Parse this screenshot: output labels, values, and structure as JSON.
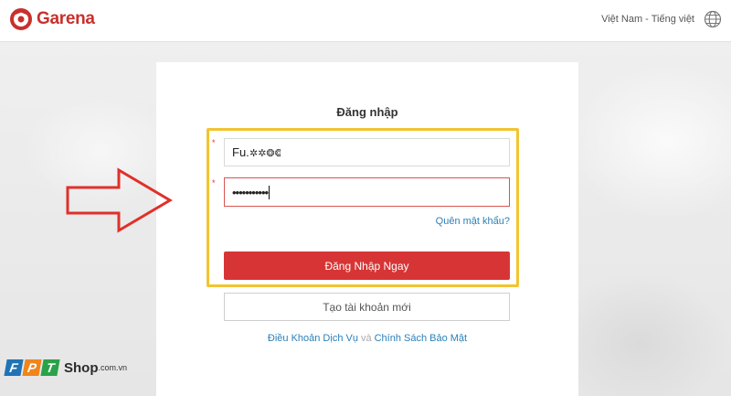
{
  "header": {
    "brand": "Garena",
    "language": "Việt Nam - Tiếng việt"
  },
  "login": {
    "title": "Đăng nhập",
    "username_value": "Fu.",
    "password_value": "•••••••••••",
    "forgot_link": "Quên mật khẩu?",
    "login_button": "Đăng Nhập Ngay",
    "create_account_button": "Tạo tài khoản mới",
    "terms_link": "Điều Khoản Dịch Vụ",
    "and_text": "và",
    "privacy_link": "Chính Sách Bảo Mật",
    "required_mark": "*"
  },
  "watermark": {
    "letters": [
      "F",
      "P",
      "T"
    ],
    "shop": "Shop",
    "domain": ".com.vn"
  },
  "colors": {
    "brand_red": "#d73535",
    "link_blue": "#2a80b9",
    "highlight_yellow": "#f2c430",
    "annotation_red": "#e0302a",
    "fpt_blue": "#1f73b7",
    "fpt_orange": "#f0851a",
    "fpt_green": "#2aa24a"
  },
  "icons": {
    "logo": "garena-logo-icon",
    "language": "globe-icon",
    "annotation": "arrow-right-icon"
  }
}
